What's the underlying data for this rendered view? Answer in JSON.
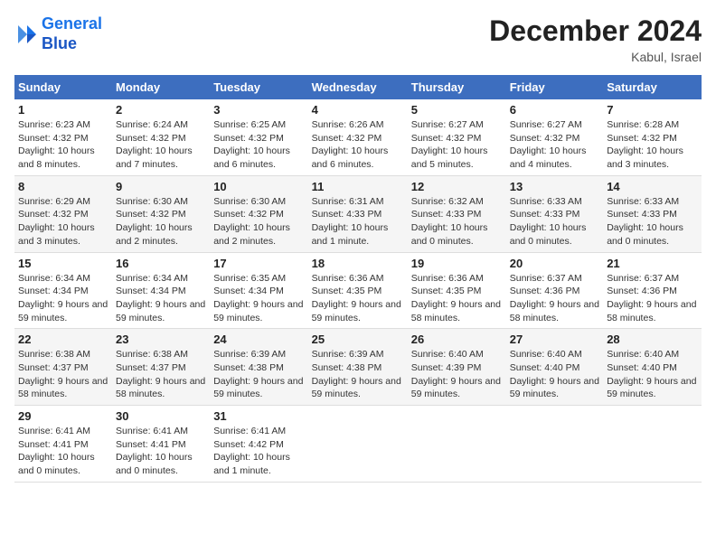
{
  "header": {
    "logo_line1": "General",
    "logo_line2": "Blue",
    "month": "December 2024",
    "location": "Kabul, Israel"
  },
  "columns": [
    "Sunday",
    "Monday",
    "Tuesday",
    "Wednesday",
    "Thursday",
    "Friday",
    "Saturday"
  ],
  "rows": [
    [
      {
        "day": "1",
        "sunrise": "6:23 AM",
        "sunset": "4:32 PM",
        "daylight": "10 hours and 8 minutes."
      },
      {
        "day": "2",
        "sunrise": "6:24 AM",
        "sunset": "4:32 PM",
        "daylight": "10 hours and 7 minutes."
      },
      {
        "day": "3",
        "sunrise": "6:25 AM",
        "sunset": "4:32 PM",
        "daylight": "10 hours and 6 minutes."
      },
      {
        "day": "4",
        "sunrise": "6:26 AM",
        "sunset": "4:32 PM",
        "daylight": "10 hours and 6 minutes."
      },
      {
        "day": "5",
        "sunrise": "6:27 AM",
        "sunset": "4:32 PM",
        "daylight": "10 hours and 5 minutes."
      },
      {
        "day": "6",
        "sunrise": "6:27 AM",
        "sunset": "4:32 PM",
        "daylight": "10 hours and 4 minutes."
      },
      {
        "day": "7",
        "sunrise": "6:28 AM",
        "sunset": "4:32 PM",
        "daylight": "10 hours and 3 minutes."
      }
    ],
    [
      {
        "day": "8",
        "sunrise": "6:29 AM",
        "sunset": "4:32 PM",
        "daylight": "10 hours and 3 minutes."
      },
      {
        "day": "9",
        "sunrise": "6:30 AM",
        "sunset": "4:32 PM",
        "daylight": "10 hours and 2 minutes."
      },
      {
        "day": "10",
        "sunrise": "6:30 AM",
        "sunset": "4:32 PM",
        "daylight": "10 hours and 2 minutes."
      },
      {
        "day": "11",
        "sunrise": "6:31 AM",
        "sunset": "4:33 PM",
        "daylight": "10 hours and 1 minute."
      },
      {
        "day": "12",
        "sunrise": "6:32 AM",
        "sunset": "4:33 PM",
        "daylight": "10 hours and 0 minutes."
      },
      {
        "day": "13",
        "sunrise": "6:33 AM",
        "sunset": "4:33 PM",
        "daylight": "10 hours and 0 minutes."
      },
      {
        "day": "14",
        "sunrise": "6:33 AM",
        "sunset": "4:33 PM",
        "daylight": "10 hours and 0 minutes."
      }
    ],
    [
      {
        "day": "15",
        "sunrise": "6:34 AM",
        "sunset": "4:34 PM",
        "daylight": "9 hours and 59 minutes."
      },
      {
        "day": "16",
        "sunrise": "6:34 AM",
        "sunset": "4:34 PM",
        "daylight": "9 hours and 59 minutes."
      },
      {
        "day": "17",
        "sunrise": "6:35 AM",
        "sunset": "4:34 PM",
        "daylight": "9 hours and 59 minutes."
      },
      {
        "day": "18",
        "sunrise": "6:36 AM",
        "sunset": "4:35 PM",
        "daylight": "9 hours and 59 minutes."
      },
      {
        "day": "19",
        "sunrise": "6:36 AM",
        "sunset": "4:35 PM",
        "daylight": "9 hours and 58 minutes."
      },
      {
        "day": "20",
        "sunrise": "6:37 AM",
        "sunset": "4:36 PM",
        "daylight": "9 hours and 58 minutes."
      },
      {
        "day": "21",
        "sunrise": "6:37 AM",
        "sunset": "4:36 PM",
        "daylight": "9 hours and 58 minutes."
      }
    ],
    [
      {
        "day": "22",
        "sunrise": "6:38 AM",
        "sunset": "4:37 PM",
        "daylight": "9 hours and 58 minutes."
      },
      {
        "day": "23",
        "sunrise": "6:38 AM",
        "sunset": "4:37 PM",
        "daylight": "9 hours and 58 minutes."
      },
      {
        "day": "24",
        "sunrise": "6:39 AM",
        "sunset": "4:38 PM",
        "daylight": "9 hours and 59 minutes."
      },
      {
        "day": "25",
        "sunrise": "6:39 AM",
        "sunset": "4:38 PM",
        "daylight": "9 hours and 59 minutes."
      },
      {
        "day": "26",
        "sunrise": "6:40 AM",
        "sunset": "4:39 PM",
        "daylight": "9 hours and 59 minutes."
      },
      {
        "day": "27",
        "sunrise": "6:40 AM",
        "sunset": "4:40 PM",
        "daylight": "9 hours and 59 minutes."
      },
      {
        "day": "28",
        "sunrise": "6:40 AM",
        "sunset": "4:40 PM",
        "daylight": "9 hours and 59 minutes."
      }
    ],
    [
      {
        "day": "29",
        "sunrise": "6:41 AM",
        "sunset": "4:41 PM",
        "daylight": "10 hours and 0 minutes."
      },
      {
        "day": "30",
        "sunrise": "6:41 AM",
        "sunset": "4:41 PM",
        "daylight": "10 hours and 0 minutes."
      },
      {
        "day": "31",
        "sunrise": "6:41 AM",
        "sunset": "4:42 PM",
        "daylight": "10 hours and 1 minute."
      },
      null,
      null,
      null,
      null
    ]
  ],
  "labels": {
    "sunrise": "Sunrise:",
    "sunset": "Sunset:",
    "daylight": "Daylight:"
  }
}
